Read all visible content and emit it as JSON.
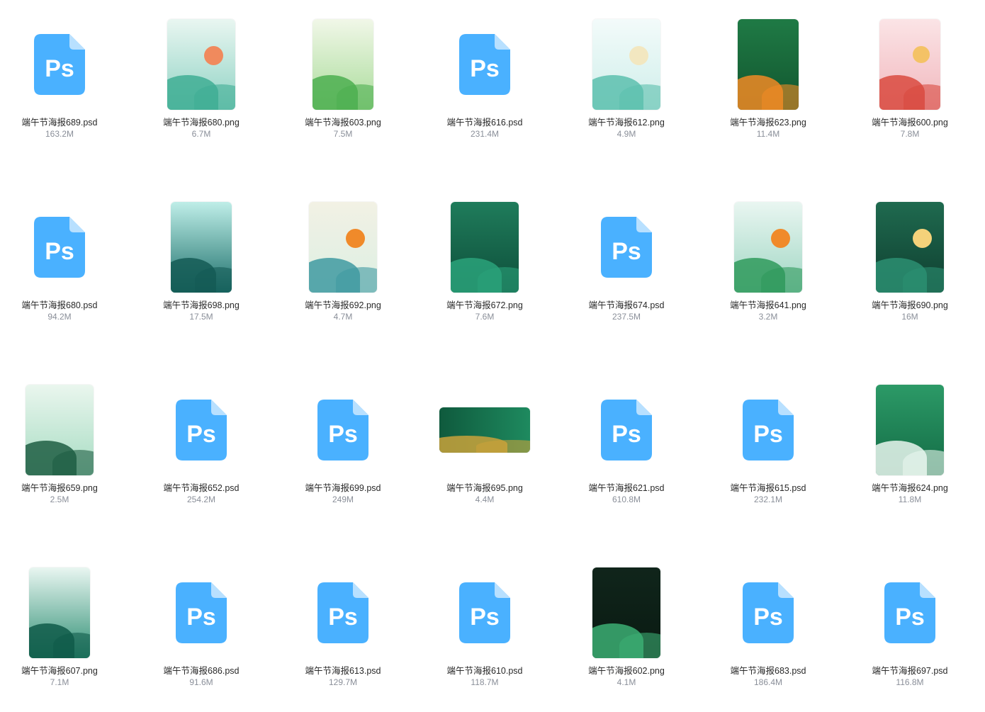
{
  "colors": {
    "ps_icon_bg": "#4ab1ff",
    "ps_icon_fold": "#b8e0ff",
    "name_text": "#2a2a2a",
    "size_text": "#8a8f99"
  },
  "ps_icon_label": "Ps",
  "files": [
    {
      "name": "端午节海报689.psd",
      "size": "163.2M",
      "type": "psd"
    },
    {
      "name": "端午节海报680.png",
      "size": "6.7M",
      "type": "png",
      "theme": "mint"
    },
    {
      "name": "端午节海报603.png",
      "size": "7.5M",
      "type": "png",
      "theme": "lightgreen"
    },
    {
      "name": "端午节海报616.psd",
      "size": "231.4M",
      "type": "psd"
    },
    {
      "name": "端午节海报612.png",
      "size": "4.9M",
      "type": "png",
      "theme": "pale"
    },
    {
      "name": "端午节海报623.png",
      "size": "11.4M",
      "type": "png",
      "theme": "deepgreen"
    },
    {
      "name": "端午节海报600.png",
      "size": "7.8M",
      "type": "png",
      "theme": "pink"
    },
    {
      "name": "端午节海报680.psd",
      "size": "94.2M",
      "type": "psd"
    },
    {
      "name": "端午节海报698.png",
      "size": "17.5M",
      "type": "png",
      "theme": "teal"
    },
    {
      "name": "端午节海报692.png",
      "size": "4.7M",
      "type": "png",
      "theme": "cream"
    },
    {
      "name": "端午节海报672.png",
      "size": "7.6M",
      "type": "png",
      "theme": "emerald"
    },
    {
      "name": "端午节海报674.psd",
      "size": "237.5M",
      "type": "psd"
    },
    {
      "name": "端午节海报641.png",
      "size": "3.2M",
      "type": "png",
      "theme": "gold"
    },
    {
      "name": "端午节海报690.png",
      "size": "16M",
      "type": "png",
      "theme": "darkgreen"
    },
    {
      "name": "端午节海报659.png",
      "size": "2.5M",
      "type": "png",
      "theme": "softgreen"
    },
    {
      "name": "端午节海报652.psd",
      "size": "254.2M",
      "type": "psd"
    },
    {
      "name": "端午节海报699.psd",
      "size": "249M",
      "type": "psd"
    },
    {
      "name": "端午节海报695.png",
      "size": "4.4M",
      "type": "png",
      "theme": "wide"
    },
    {
      "name": "端午节海报621.psd",
      "size": "610.8M",
      "type": "psd"
    },
    {
      "name": "端午节海报615.psd",
      "size": "232.1M",
      "type": "psd"
    },
    {
      "name": "端午节海报624.png",
      "size": "11.8M",
      "type": "png",
      "theme": "waves"
    },
    {
      "name": "端午节海报607.png",
      "size": "7.1M",
      "type": "png",
      "theme": "seagreen"
    },
    {
      "name": "端午节海报686.psd",
      "size": "91.6M",
      "type": "psd"
    },
    {
      "name": "端午节海报613.psd",
      "size": "129.7M",
      "type": "psd"
    },
    {
      "name": "端午节海报610.psd",
      "size": "118.7M",
      "type": "psd"
    },
    {
      "name": "端午节海报602.png",
      "size": "4.1M",
      "type": "png",
      "theme": "black"
    },
    {
      "name": "端午节海报683.psd",
      "size": "186.4M",
      "type": "psd"
    },
    {
      "name": "端午节海报697.psd",
      "size": "116.8M",
      "type": "psd"
    }
  ]
}
